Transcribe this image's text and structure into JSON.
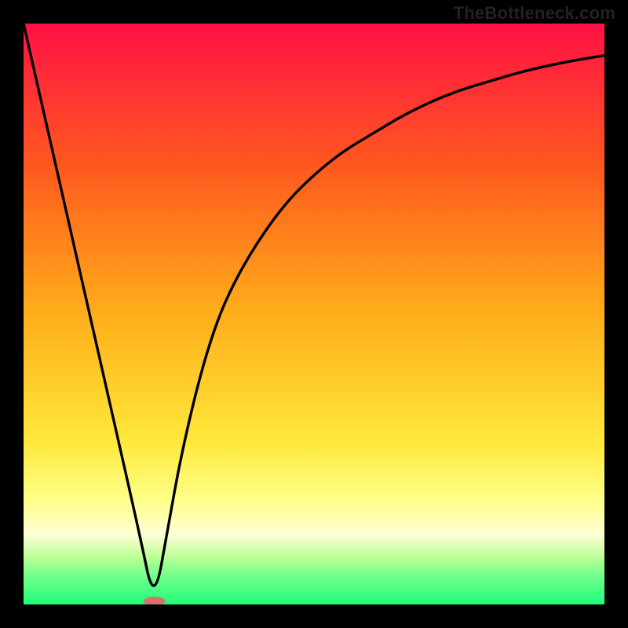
{
  "watermark": "TheBottleneck.com",
  "chart_data": {
    "type": "line",
    "title": "",
    "xlabel": "",
    "ylabel": "",
    "xlim": [
      0,
      100
    ],
    "ylim": [
      0,
      100
    ],
    "grid": false,
    "legend": false,
    "gradient_stops": [
      {
        "offset": 0,
        "color": "#ff1045"
      },
      {
        "offset": 25,
        "color": "#ff5a1e"
      },
      {
        "offset": 50,
        "color": "#ffae1a"
      },
      {
        "offset": 72,
        "color": "#ffe83a"
      },
      {
        "offset": 82,
        "color": "#ffff8a"
      },
      {
        "offset": 88,
        "color": "#ffffd6"
      },
      {
        "offset": 92,
        "color": "#b9ff94"
      },
      {
        "offset": 95,
        "color": "#74ff8c"
      },
      {
        "offset": 100,
        "color": "#1fff79"
      }
    ],
    "marker": {
      "x": 22.5,
      "y": 0,
      "color": "#d8726e",
      "shape": "pill"
    },
    "series": [
      {
        "name": "curve",
        "x": [
          0,
          5,
          10,
          15,
          20,
          22.5,
          25,
          27,
          30,
          33,
          36,
          40,
          45,
          50,
          55,
          60,
          65,
          70,
          75,
          80,
          85,
          90,
          95,
          100
        ],
        "values": [
          100,
          78,
          56,
          34,
          12,
          0,
          14,
          25,
          38,
          48,
          55,
          62,
          69,
          74,
          78,
          81,
          84,
          86.5,
          88.5,
          90,
          91.5,
          92.7,
          93.7,
          94.5
        ]
      }
    ]
  }
}
